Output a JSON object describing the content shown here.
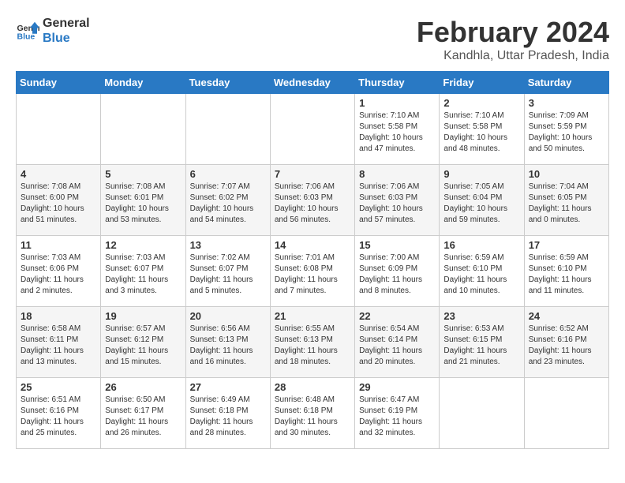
{
  "logo": {
    "line1": "General",
    "line2": "Blue"
  },
  "title": "February 2024",
  "subtitle": "Kandhla, Uttar Pradesh, India",
  "weekdays": [
    "Sunday",
    "Monday",
    "Tuesday",
    "Wednesday",
    "Thursday",
    "Friday",
    "Saturday"
  ],
  "weeks": [
    [
      {
        "day": "",
        "info": ""
      },
      {
        "day": "",
        "info": ""
      },
      {
        "day": "",
        "info": ""
      },
      {
        "day": "",
        "info": ""
      },
      {
        "day": "1",
        "info": "Sunrise: 7:10 AM\nSunset: 5:58 PM\nDaylight: 10 hours\nand 47 minutes."
      },
      {
        "day": "2",
        "info": "Sunrise: 7:10 AM\nSunset: 5:58 PM\nDaylight: 10 hours\nand 48 minutes."
      },
      {
        "day": "3",
        "info": "Sunrise: 7:09 AM\nSunset: 5:59 PM\nDaylight: 10 hours\nand 50 minutes."
      }
    ],
    [
      {
        "day": "4",
        "info": "Sunrise: 7:08 AM\nSunset: 6:00 PM\nDaylight: 10 hours\nand 51 minutes."
      },
      {
        "day": "5",
        "info": "Sunrise: 7:08 AM\nSunset: 6:01 PM\nDaylight: 10 hours\nand 53 minutes."
      },
      {
        "day": "6",
        "info": "Sunrise: 7:07 AM\nSunset: 6:02 PM\nDaylight: 10 hours\nand 54 minutes."
      },
      {
        "day": "7",
        "info": "Sunrise: 7:06 AM\nSunset: 6:03 PM\nDaylight: 10 hours\nand 56 minutes."
      },
      {
        "day": "8",
        "info": "Sunrise: 7:06 AM\nSunset: 6:03 PM\nDaylight: 10 hours\nand 57 minutes."
      },
      {
        "day": "9",
        "info": "Sunrise: 7:05 AM\nSunset: 6:04 PM\nDaylight: 10 hours\nand 59 minutes."
      },
      {
        "day": "10",
        "info": "Sunrise: 7:04 AM\nSunset: 6:05 PM\nDaylight: 11 hours\nand 0 minutes."
      }
    ],
    [
      {
        "day": "11",
        "info": "Sunrise: 7:03 AM\nSunset: 6:06 PM\nDaylight: 11 hours\nand 2 minutes."
      },
      {
        "day": "12",
        "info": "Sunrise: 7:03 AM\nSunset: 6:07 PM\nDaylight: 11 hours\nand 3 minutes."
      },
      {
        "day": "13",
        "info": "Sunrise: 7:02 AM\nSunset: 6:07 PM\nDaylight: 11 hours\nand 5 minutes."
      },
      {
        "day": "14",
        "info": "Sunrise: 7:01 AM\nSunset: 6:08 PM\nDaylight: 11 hours\nand 7 minutes."
      },
      {
        "day": "15",
        "info": "Sunrise: 7:00 AM\nSunset: 6:09 PM\nDaylight: 11 hours\nand 8 minutes."
      },
      {
        "day": "16",
        "info": "Sunrise: 6:59 AM\nSunset: 6:10 PM\nDaylight: 11 hours\nand 10 minutes."
      },
      {
        "day": "17",
        "info": "Sunrise: 6:59 AM\nSunset: 6:10 PM\nDaylight: 11 hours\nand 11 minutes."
      }
    ],
    [
      {
        "day": "18",
        "info": "Sunrise: 6:58 AM\nSunset: 6:11 PM\nDaylight: 11 hours\nand 13 minutes."
      },
      {
        "day": "19",
        "info": "Sunrise: 6:57 AM\nSunset: 6:12 PM\nDaylight: 11 hours\nand 15 minutes."
      },
      {
        "day": "20",
        "info": "Sunrise: 6:56 AM\nSunset: 6:13 PM\nDaylight: 11 hours\nand 16 minutes."
      },
      {
        "day": "21",
        "info": "Sunrise: 6:55 AM\nSunset: 6:13 PM\nDaylight: 11 hours\nand 18 minutes."
      },
      {
        "day": "22",
        "info": "Sunrise: 6:54 AM\nSunset: 6:14 PM\nDaylight: 11 hours\nand 20 minutes."
      },
      {
        "day": "23",
        "info": "Sunrise: 6:53 AM\nSunset: 6:15 PM\nDaylight: 11 hours\nand 21 minutes."
      },
      {
        "day": "24",
        "info": "Sunrise: 6:52 AM\nSunset: 6:16 PM\nDaylight: 11 hours\nand 23 minutes."
      }
    ],
    [
      {
        "day": "25",
        "info": "Sunrise: 6:51 AM\nSunset: 6:16 PM\nDaylight: 11 hours\nand 25 minutes."
      },
      {
        "day": "26",
        "info": "Sunrise: 6:50 AM\nSunset: 6:17 PM\nDaylight: 11 hours\nand 26 minutes."
      },
      {
        "day": "27",
        "info": "Sunrise: 6:49 AM\nSunset: 6:18 PM\nDaylight: 11 hours\nand 28 minutes."
      },
      {
        "day": "28",
        "info": "Sunrise: 6:48 AM\nSunset: 6:18 PM\nDaylight: 11 hours\nand 30 minutes."
      },
      {
        "day": "29",
        "info": "Sunrise: 6:47 AM\nSunset: 6:19 PM\nDaylight: 11 hours\nand 32 minutes."
      },
      {
        "day": "",
        "info": ""
      },
      {
        "day": "",
        "info": ""
      }
    ]
  ]
}
